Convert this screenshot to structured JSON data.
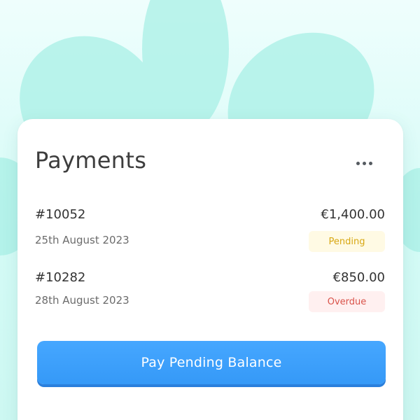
{
  "colors": {
    "accent": "#3d9cf8",
    "pending_text": "#d8a713",
    "pending_bg": "#fffae4",
    "overdue_text": "#d9534a",
    "overdue_bg": "#fff0f0",
    "background": "#d4fbf6",
    "petals": "#a9f0e6"
  },
  "header": {
    "title": "Payments",
    "more_icon": "more-horizontal-icon"
  },
  "payments": [
    {
      "id": "#10052",
      "date": "25th August 2023",
      "amount": "€1,400.00",
      "status": "Pending"
    },
    {
      "id": "#10282",
      "date": "28th August 2023",
      "amount": "€850.00",
      "status": "Overdue"
    }
  ],
  "actions": {
    "pay_label": "Pay Pending Balance"
  }
}
